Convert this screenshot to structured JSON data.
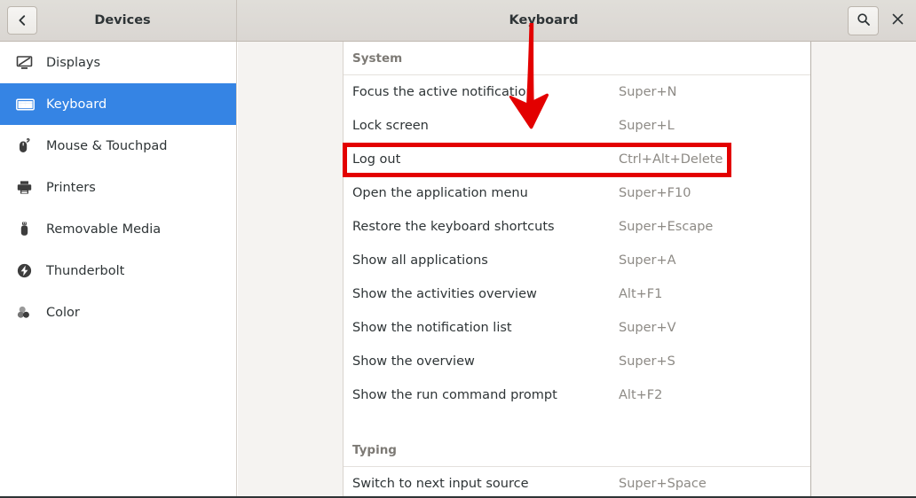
{
  "window": {
    "sidebar_title": "Devices",
    "content_title": "Keyboard",
    "back_icon": "chevron-left-icon",
    "search_icon": "search-icon",
    "close_icon": "close-icon"
  },
  "sidebar": {
    "items": [
      {
        "label": "Displays",
        "icon": "display-icon",
        "selected": false
      },
      {
        "label": "Keyboard",
        "icon": "keyboard-icon",
        "selected": true
      },
      {
        "label": "Mouse & Touchpad",
        "icon": "mouse-icon",
        "selected": false
      },
      {
        "label": "Printers",
        "icon": "printer-icon",
        "selected": false
      },
      {
        "label": "Removable Media",
        "icon": "usb-drive-icon",
        "selected": false
      },
      {
        "label": "Thunderbolt",
        "icon": "thunderbolt-icon",
        "selected": false
      },
      {
        "label": "Color",
        "icon": "color-profile-icon",
        "selected": false
      }
    ]
  },
  "shortcuts": {
    "sections": [
      {
        "title": "System",
        "rows": [
          {
            "name": "Focus the active notification",
            "accel": "Super+N"
          },
          {
            "name": "Lock screen",
            "accel": "Super+L"
          },
          {
            "name": "Log out",
            "accel": "Ctrl+Alt+Delete",
            "highlighted": true
          },
          {
            "name": "Open the application menu",
            "accel": "Super+F10"
          },
          {
            "name": "Restore the keyboard shortcuts",
            "accel": "Super+Escape"
          },
          {
            "name": "Show all applications",
            "accel": "Super+A"
          },
          {
            "name": "Show the activities overview",
            "accel": "Alt+F1"
          },
          {
            "name": "Show the notification list",
            "accel": "Super+V"
          },
          {
            "name": "Show the overview",
            "accel": "Super+S"
          },
          {
            "name": "Show the run command prompt",
            "accel": "Alt+F2"
          }
        ]
      },
      {
        "title": "Typing",
        "rows": [
          {
            "name": "Switch to next input source",
            "accel": "Super+Space"
          }
        ]
      }
    ]
  },
  "annotations": {
    "highlight_color": "#e30000",
    "arrow": {
      "name": "red-down-arrow",
      "target": "Log out"
    },
    "rect": {
      "name": "red-highlight-rectangle",
      "target": "Log out"
    }
  },
  "colors": {
    "accent": "#3584e4",
    "headerbar": "#dcd8d3",
    "panel": "#ffffff",
    "gutter": "#f5f3f1",
    "annotation": "#e30000"
  }
}
